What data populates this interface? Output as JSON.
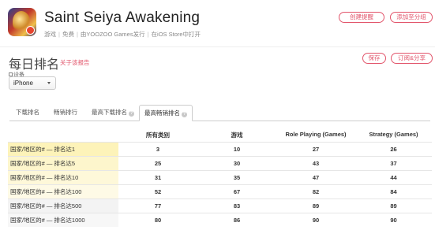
{
  "app": {
    "title": "Saint Seiya Awakening",
    "meta": [
      "游戏",
      "免费",
      "由YOOZOO Games发行",
      "在iOS Store中打开"
    ],
    "icon": "app-icon"
  },
  "header": {
    "create_alert": "创建提醒",
    "add_to_group": "添加至分组"
  },
  "page": {
    "title": "每日排名",
    "report_link": "关于该报告",
    "save": "保存",
    "subscribe": "订阅&分享",
    "device_label": "设备",
    "device_value": "iPhone"
  },
  "tabs": [
    "下载排名",
    "畅销排行",
    "最高下载排名",
    "最高畅销排名"
  ],
  "table": {
    "columns": [
      "所有类别",
      "游戏",
      "Role Playing (Games)",
      "Strategy (Games)"
    ],
    "rows": [
      {
        "label": "国家/地区的# — 排名达1",
        "values": [
          "3",
          "10",
          "27",
          "26"
        ],
        "color": "#fdf3b9"
      },
      {
        "label": "国家/地区的# — 排名达5",
        "values": [
          "25",
          "30",
          "43",
          "37"
        ],
        "color": "#fdf6cc"
      },
      {
        "label": "国家/地区的# — 排名达10",
        "values": [
          "31",
          "35",
          "47",
          "44"
        ],
        "color": "#fef8d9"
      },
      {
        "label": "国家/地区的# — 排名达100",
        "values": [
          "52",
          "67",
          "82",
          "84"
        ],
        "color": "#fefae6"
      },
      {
        "label": "国家/地区的# — 排名达500",
        "values": [
          "77",
          "83",
          "89",
          "89"
        ],
        "color": "#f3f3f3"
      },
      {
        "label": "国家/地区的# — 排名达1000",
        "values": [
          "80",
          "86",
          "90",
          "90"
        ],
        "color": "#f7f7f7"
      }
    ]
  }
}
